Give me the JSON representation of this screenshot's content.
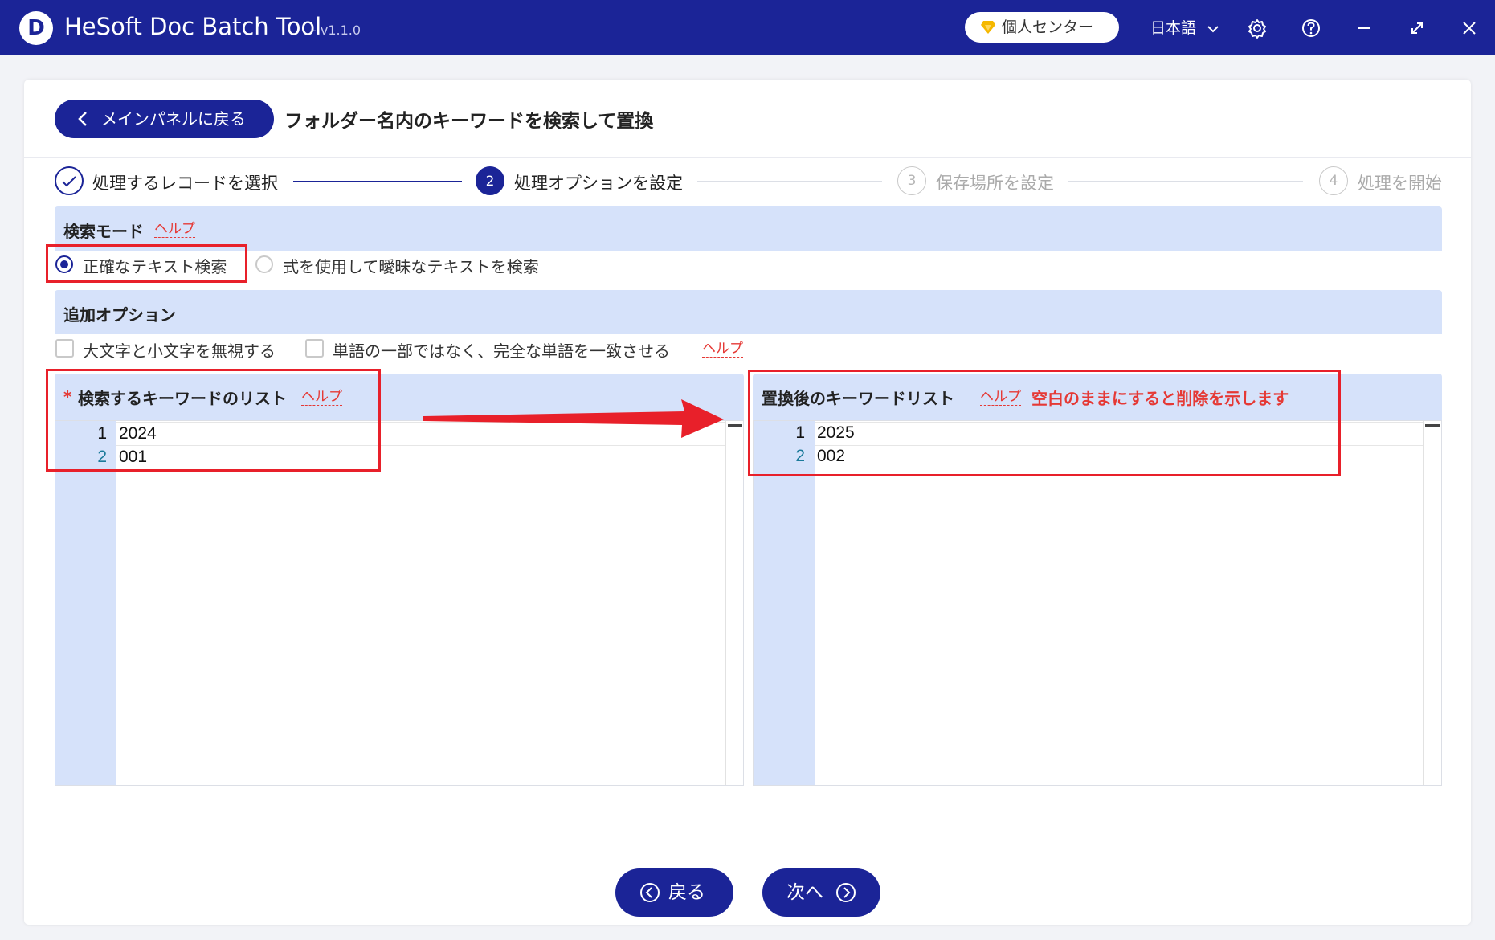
{
  "app": {
    "logo_letter": "D",
    "title": "HeSoft Doc Batch Tool",
    "version": "- v1.1.0",
    "personal_center": "個人センター",
    "language": "日本語"
  },
  "header": {
    "back_button": "メインパネルに戻る",
    "page_title": "フォルダー名内のキーワードを検索して置換"
  },
  "steps": [
    {
      "number": "✓",
      "label": "処理するレコードを選択",
      "state": "done"
    },
    {
      "number": "2",
      "label": "処理オプションを設定",
      "state": "active"
    },
    {
      "number": "3",
      "label": "保存場所を設定",
      "state": "pending"
    },
    {
      "number": "4",
      "label": "処理を開始",
      "state": "pending"
    }
  ],
  "search_mode": {
    "title": "検索モード",
    "help": "ヘルプ",
    "options": [
      "正確なテキスト検索",
      "式を使用して曖昧なテキストを検索"
    ],
    "selected": 0
  },
  "extra_options": {
    "title": "追加オプション",
    "options": [
      "大文字と小文字を無視する",
      "単語の一部ではなく、完全な単語を一致させる"
    ],
    "help": "ヘルプ"
  },
  "search_list": {
    "required_mark": "*",
    "title": "検索するキーワードのリスト",
    "help": "ヘルプ",
    "lines": [
      "2024",
      "001"
    ],
    "line_numbers": [
      "1",
      "2"
    ]
  },
  "replace_list": {
    "title": "置換後のキーワードリスト",
    "help": "ヘルプ",
    "note": "空白のままにすると削除を示します",
    "lines": [
      "2025",
      "002"
    ],
    "line_numbers": [
      "1",
      "2"
    ]
  },
  "footer": {
    "back": "戻る",
    "next": "次へ"
  },
  "colors": {
    "brand": "#1b2497",
    "section_bg": "#d6e2fa",
    "help": "#e53935",
    "annotation": "#e8202a",
    "personal_center_gem": "#f5b800"
  },
  "icons": [
    "app-logo-icon",
    "gem-icon",
    "chevron-down-icon",
    "gear-icon",
    "help-icon",
    "minimize-icon",
    "maximize-icon",
    "close-icon",
    "chevron-left-icon",
    "check-icon",
    "circle-arrow-left-icon",
    "circle-arrow-right-icon"
  ]
}
